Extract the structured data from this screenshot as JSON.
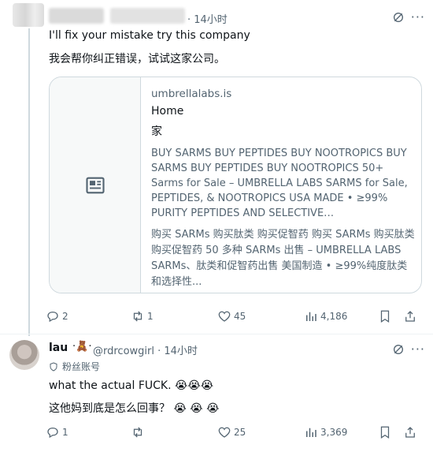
{
  "tweet1": {
    "time": "· 14小时",
    "text_en": "I'll fix your mistake try this company",
    "text_zh": "我会帮你纠正错误，试试这家公司。",
    "card": {
      "domain": "umbrellalabs.is",
      "title": "Home",
      "title_zh": "家",
      "description": "BUY SARMS BUY PEPTIDES BUY NOOTROPICS BUY SARMS BUY PEPTIDES BUY NOOTROPICS 50+ Sarms for Sale – UMBRELLA LABS SARMS for Sale, PEPTIDES, & NOOTROPICS USA MADE • ≥99% PURITY PEPTIDES AND SELECTIVE…",
      "description_zh": "购买 SARMs 购买肽类 购买促智药 购买 SARMs 购买肽类 购买促智药 50 多种 SARMs 出售 – UMBRELLA LABS SARMs、肽类和促智药出售 美国制造 • ≥99%纯度肽类和选择性..."
    },
    "actions": {
      "replies": "2",
      "reposts": "1",
      "likes": "45",
      "views": "4,186"
    }
  },
  "tweet2": {
    "name": "lau",
    "name_suffix": "·🧸·",
    "handle": "@rdrcowgirl · 14小时",
    "subtitle": "粉丝账号",
    "text_en": "what the actual FUCK. 😭😭😭",
    "text_zh": "这他妈到底是怎么回事？ 😭 😭 😭",
    "actions": {
      "replies": "1",
      "reposts": "",
      "likes": "25",
      "views": "3,369"
    }
  },
  "colors": {
    "text": "#0f1419",
    "secondary": "#536471",
    "border": "#cfd9de"
  }
}
